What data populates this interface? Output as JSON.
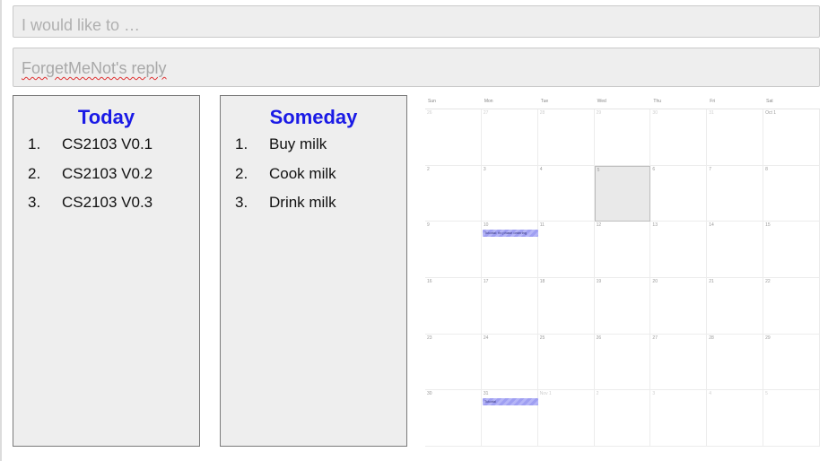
{
  "command": {
    "placeholder": "I would like to …"
  },
  "reply": {
    "text": "ForgetMeNot's reply"
  },
  "today": {
    "title": "Today",
    "items": [
      {
        "num": "1.",
        "text": "CS2103 V0.1"
      },
      {
        "num": "2.",
        "text": "CS2103 V0.2"
      },
      {
        "num": "3.",
        "text": "CS2103 V0.3"
      }
    ]
  },
  "someday": {
    "title": "Someday",
    "items": [
      {
        "num": "1.",
        "text": "Buy milk"
      },
      {
        "num": "2.",
        "text": "Cook milk"
      },
      {
        "num": "3.",
        "text": "Drink milk"
      }
    ]
  },
  "calendar": {
    "weekdays": [
      "Sun",
      "Mon",
      "Tue",
      "Wed",
      "Thu",
      "Fri",
      "Sat"
    ],
    "weeks": [
      [
        "26",
        "27",
        "28",
        "29",
        "30",
        "31",
        "Oct 1"
      ],
      [
        "2",
        "3",
        "4",
        "5",
        "6",
        "7",
        "8"
      ],
      [
        "9",
        "10",
        "11",
        "12",
        "13",
        "14",
        "15"
      ],
      [
        "16",
        "17",
        "18",
        "19",
        "20",
        "21",
        "22"
      ],
      [
        "23",
        "24",
        "25",
        "26",
        "27",
        "28",
        "29"
      ],
      [
        "30",
        "31",
        "Nov 1",
        "2",
        "3",
        "4",
        "5"
      ]
    ],
    "selected": {
      "week": 1,
      "day": 3
    },
    "events": [
      {
        "week": 2,
        "day": 1,
        "title": "Tutorial: fix phase ordering"
      },
      {
        "week": 5,
        "day": 1,
        "title": "Tutorial"
      }
    ],
    "colors": {
      "event": "#a5a5f5",
      "selected": "#e9e9e9"
    }
  }
}
